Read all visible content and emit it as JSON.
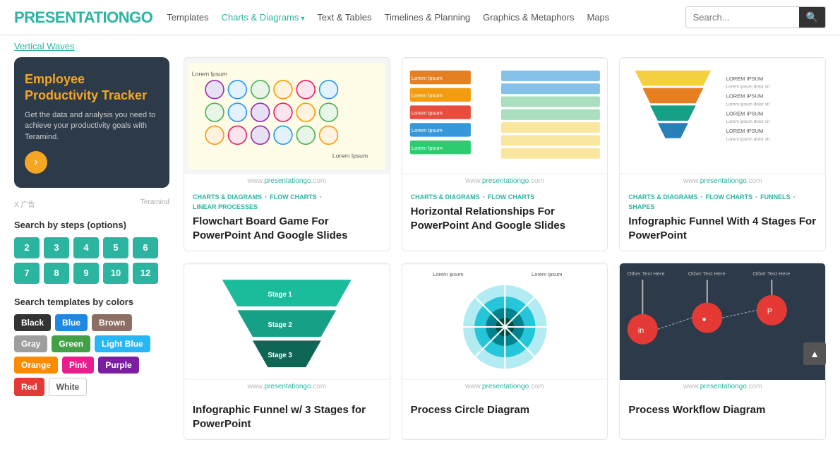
{
  "header": {
    "logo_main": "PRESENTATION",
    "logo_accent": "GO",
    "nav": [
      {
        "label": "Templates",
        "active": false
      },
      {
        "label": "Charts & Diagrams",
        "active": true,
        "has_chevron": true
      },
      {
        "label": "Text & Tables",
        "active": false
      },
      {
        "label": "Timelines & Planning",
        "active": false
      },
      {
        "label": "Graphics & Metaphors",
        "active": false
      },
      {
        "label": "Maps",
        "active": false
      }
    ],
    "search_placeholder": "Search..."
  },
  "breadcrumb": {
    "link_text": "Vertical Waves"
  },
  "sidebar": {
    "ad": {
      "title": "Employee Productivity Tracker",
      "text": "Get the data and analysis you need to achieve your productivity goals with Teramind.",
      "ad_label": "X 广告",
      "brand": "Teramind"
    },
    "steps_title": "Search by steps (options)",
    "steps": [
      "2",
      "3",
      "4",
      "5",
      "6",
      "7",
      "8",
      "9",
      "10",
      "12"
    ],
    "colors_title": "Search templates by colors",
    "colors": [
      {
        "label": "Black",
        "bg": "#333333",
        "text": "#fff"
      },
      {
        "label": "Blue",
        "bg": "#1e88e5",
        "text": "#fff"
      },
      {
        "label": "Brown",
        "bg": "#8d6e63",
        "text": "#fff"
      },
      {
        "label": "Gray",
        "bg": "#9e9e9e",
        "text": "#fff"
      },
      {
        "label": "Green",
        "bg": "#43a047",
        "text": "#fff"
      },
      {
        "label": "Light Blue",
        "bg": "#29b6f6",
        "text": "#fff"
      },
      {
        "label": "Orange",
        "bg": "#fb8c00",
        "text": "#fff"
      },
      {
        "label": "Pink",
        "bg": "#e91e8c",
        "text": "#fff"
      },
      {
        "label": "Purple",
        "bg": "#7b1fa2",
        "text": "#fff"
      },
      {
        "label": "Red",
        "bg": "#e53935",
        "text": "#fff"
      },
      {
        "label": "White",
        "bg": "#ffffff",
        "text": "#555",
        "border": true
      }
    ]
  },
  "cards": [
    {
      "id": "card1",
      "domain_prefix": "www.",
      "domain_name": "presentationgo",
      "domain_suffix": ".com",
      "tags": [
        "CHARTS & DIAGRAMS",
        "FLOW CHARTS",
        "LINEAR PROCESSES"
      ],
      "title": "Flowchart Board Game For PowerPoint And Google Slides",
      "chart_type": "flowchart_board"
    },
    {
      "id": "card2",
      "domain_prefix": "www.",
      "domain_name": "presentationgo",
      "domain_suffix": ".com",
      "tags": [
        "CHARTS & DIAGRAMS",
        "FLOW CHARTS"
      ],
      "title": "Horizontal Relationships For PowerPoint And Google Slides",
      "chart_type": "horizontal_rel"
    },
    {
      "id": "card3",
      "domain_prefix": "www.",
      "domain_name": "presentationgo",
      "domain_suffix": ".com",
      "tags": [
        "CHARTS & DIAGRAMS",
        "FLOW CHARTS",
        "FUNNELS",
        "SHAPES"
      ],
      "title": "Infographic Funnel With 4 Stages For PowerPoint",
      "chart_type": "funnel4"
    },
    {
      "id": "card4",
      "domain_prefix": "www.",
      "domain_name": "presentationgo",
      "domain_suffix": ".com",
      "tags": [],
      "title": "Infographic Funnel w/ 3 Stages for PowerPoint",
      "chart_type": "funnel3"
    },
    {
      "id": "card5",
      "domain_prefix": "www.",
      "domain_name": "presentationgo",
      "domain_suffix": ".com",
      "tags": [],
      "title": "Process Circle Diagram",
      "chart_type": "circle"
    },
    {
      "id": "card6",
      "domain_prefix": "www.",
      "domain_name": "presentationgo",
      "domain_suffix": ".com",
      "tags": [],
      "title": "Process Workflow Diagram",
      "chart_type": "workflow",
      "dark": true
    }
  ],
  "scroll_btn": "▲"
}
